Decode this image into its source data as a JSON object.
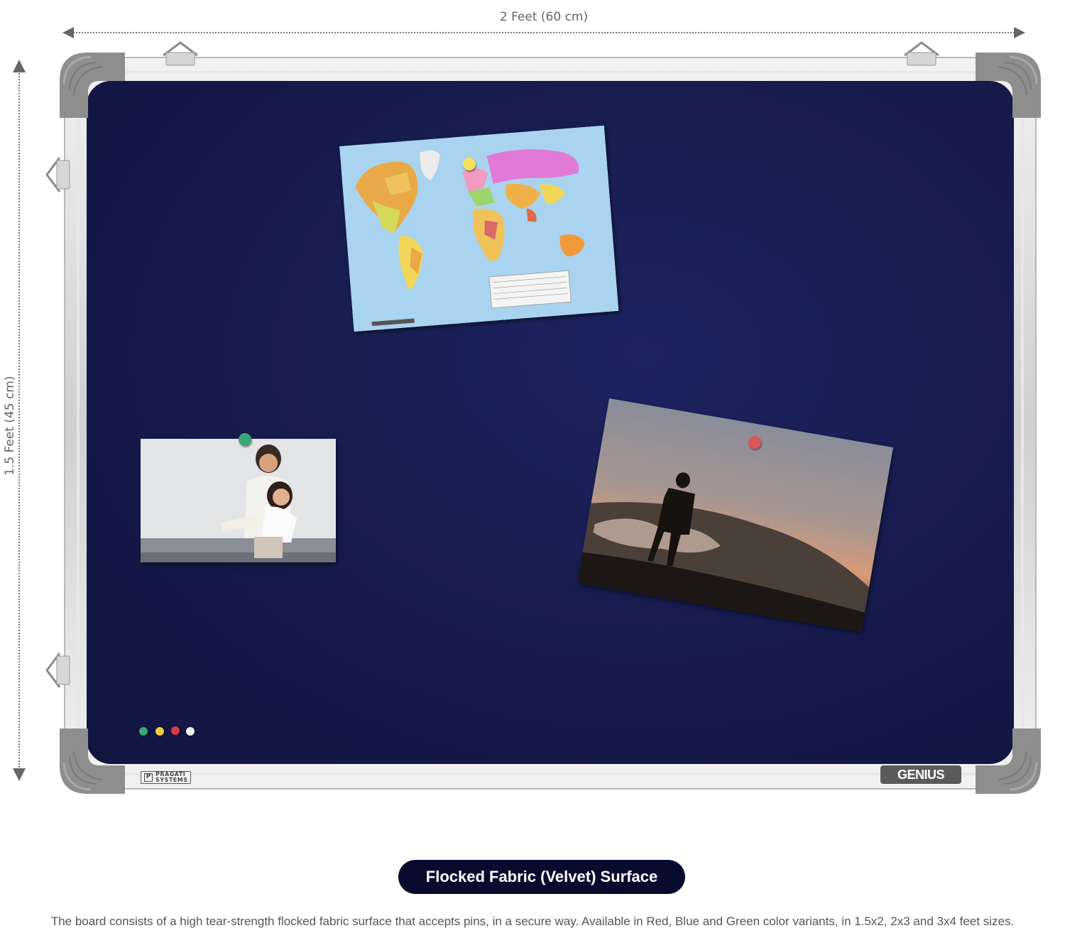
{
  "dimensions": {
    "width_label": "2 Feet (60 cm)",
    "height_label": "1.5 Feet (45 cm)"
  },
  "board": {
    "surface_color": "#161a4a",
    "frame_color": "#d9d9d9",
    "corner_color": "#8f8f8f",
    "brand_left": {
      "mark": "P",
      "line1": "PRAGATI",
      "line2": "SYSTEMS"
    },
    "brand_right": "GENIUS",
    "pins": [
      "#f5e25a",
      "#3aa576",
      "#d9565a"
    ],
    "pin_row": [
      "#3aa576",
      "#f2cf3a",
      "#d9394b",
      "#f0f0f0"
    ]
  },
  "caption": {
    "badge": "Flocked Fabric (Velvet) Surface",
    "description": "The board consists of a high tear-strength flocked fabric surface that accepts pins, in a secure way. Available in Red, Blue and Green color variants, in 1.5x2, 2x3 and 3x4 feet sizes."
  }
}
